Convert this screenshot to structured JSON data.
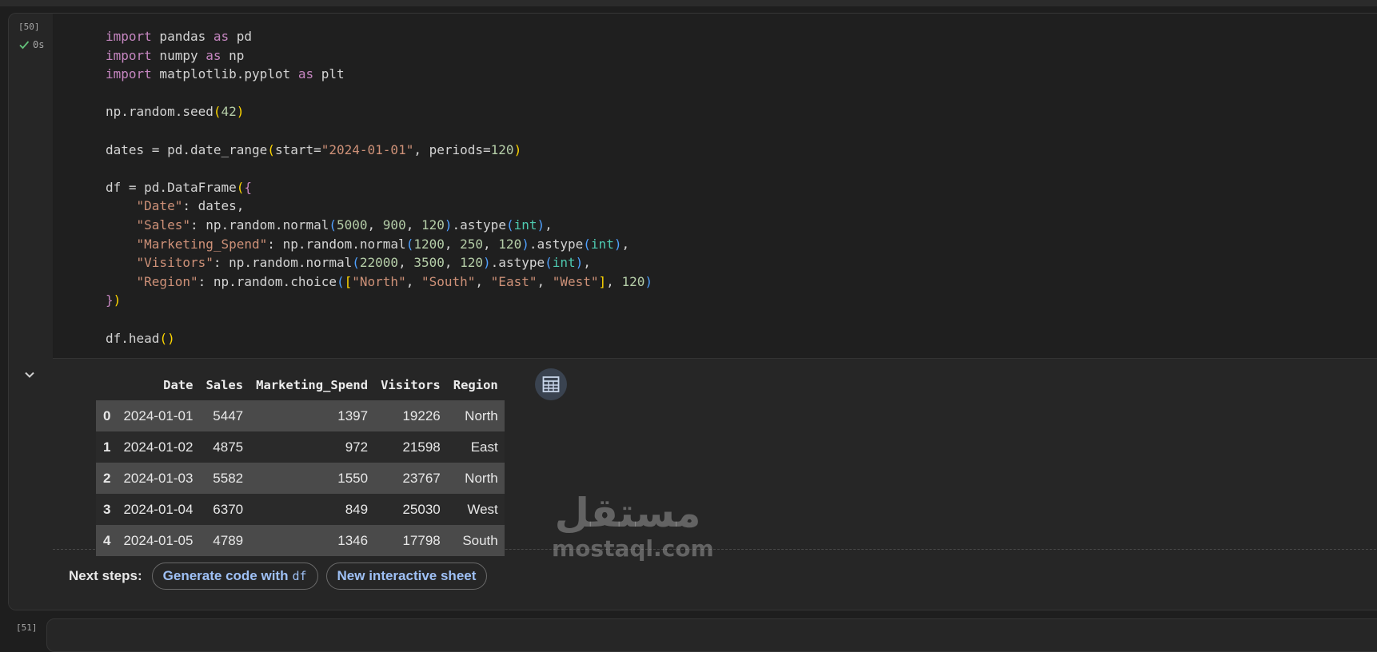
{
  "cell": {
    "exec_count": "[50]",
    "duration": "0s",
    "code_lines": [
      "import pandas as pd",
      "import numpy as np",
      "import matplotlib.pyplot as plt",
      "",
      "np.random.seed(42)",
      "",
      "dates = pd.date_range(start=\"2024-01-01\", periods=120)",
      "",
      "df = pd.DataFrame({",
      "    \"Date\": dates,",
      "    \"Sales\": np.random.normal(5000, 900, 120).astype(int),",
      "    \"Marketing_Spend\": np.random.normal(1200, 250, 120).astype(int),",
      "    \"Visitors\": np.random.normal(22000, 3500, 120).astype(int),",
      "    \"Region\": np.random.choice([\"North\", \"South\", \"East\", \"West\"], 120)",
      "})",
      "",
      "df.head()"
    ]
  },
  "output": {
    "columns": [
      "",
      "Date",
      "Sales",
      "Marketing_Spend",
      "Visitors",
      "Region"
    ],
    "rows": [
      [
        "0",
        "2024-01-01",
        "5447",
        "1397",
        "19226",
        "North"
      ],
      [
        "1",
        "2024-01-02",
        "4875",
        "972",
        "21598",
        "East"
      ],
      [
        "2",
        "2024-01-03",
        "5582",
        "1550",
        "23767",
        "North"
      ],
      [
        "3",
        "2024-01-04",
        "6370",
        "849",
        "25030",
        "West"
      ],
      [
        "4",
        "2024-01-05",
        "4789",
        "1346",
        "17798",
        "South"
      ]
    ],
    "next_steps": {
      "label": "Next steps:",
      "generate_label": "Generate code with",
      "generate_var": "df",
      "sheet_label": "New interactive sheet"
    }
  },
  "next_cell": {
    "exec_count": "[51]"
  },
  "watermark": {
    "arabic": "مستقل",
    "latin": "mostaql.com"
  },
  "icons": {
    "status": "check-icon",
    "collapse": "chevron-down-icon",
    "table": "table-grid-icon"
  },
  "colors": {
    "keyword": "#c586c0",
    "string": "#ce9178",
    "number": "#b5cea8",
    "builtin": "#4ec9b0",
    "chip_text": "#9ec0f5"
  }
}
